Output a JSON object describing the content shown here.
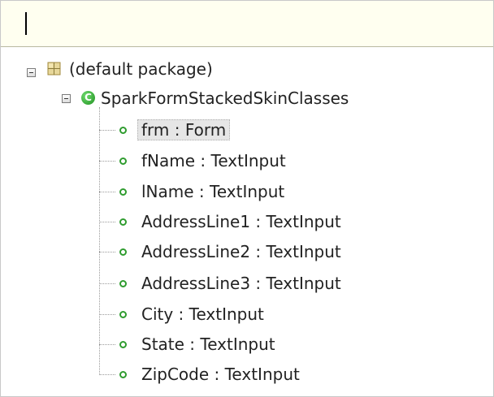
{
  "filter": {
    "value": "",
    "placeholder": ""
  },
  "tree": {
    "package": {
      "label": "(default package)",
      "icon": "package-icon"
    },
    "class": {
      "label": "SparkFormStackedSkinClasses",
      "icon": "class-icon"
    },
    "fields": [
      {
        "label": "frm : Form",
        "selected": true
      },
      {
        "label": "fName : TextInput"
      },
      {
        "label": "lName : TextInput"
      },
      {
        "label": "AddressLine1 : TextInput"
      },
      {
        "label": "AddressLine2 : TextInput"
      },
      {
        "label": "AddressLine3 : TextInput"
      },
      {
        "label": "City : TextInput"
      },
      {
        "label": "State : TextInput"
      },
      {
        "label": "ZipCode : TextInput"
      }
    ]
  },
  "colors": {
    "filter_bg": "#fffff0",
    "field_icon": "#2f9c2f",
    "class_icon": "#1f8f1f",
    "selection_bg": "#e6e6e6"
  }
}
